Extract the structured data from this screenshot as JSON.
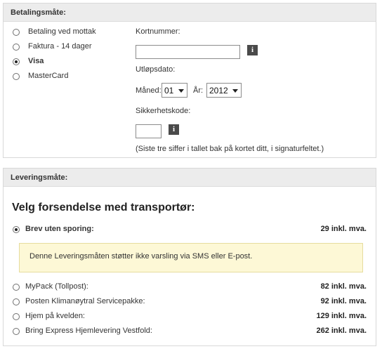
{
  "payment": {
    "header": "Betalingsmåte:",
    "options": [
      {
        "label": "Betaling ved mottak",
        "checked": false
      },
      {
        "label": "Faktura - 14 dager",
        "checked": false
      },
      {
        "label": "Visa",
        "checked": true
      },
      {
        "label": "MasterCard",
        "checked": false
      }
    ],
    "card_number_label": "Kortnummer:",
    "card_number_value": "",
    "expiry_label": "Utløpsdato:",
    "month_label": "Måned:",
    "month_value": "01",
    "year_label": "År:",
    "year_value": "2012",
    "security_code_label": "Sikkerhetskode:",
    "security_code_value": "",
    "security_hint": "(Siste tre siffer i tallet bak på kortet ditt, i signaturfeltet.)",
    "info_glyph": "i"
  },
  "delivery": {
    "header": "Leveringsmåte:",
    "heading": "Velg forsendelse med transportør:",
    "options": [
      {
        "label": "Brev uten sporing:",
        "price": "29 inkl. mva.",
        "checked": true
      },
      {
        "label": "MyPack (Tollpost):",
        "price": "82 inkl. mva.",
        "checked": false
      },
      {
        "label": "Posten Klimanøytral Servicepakke:",
        "price": "92 inkl. mva.",
        "checked": false
      },
      {
        "label": "Hjem på kvelden:",
        "price": "129 inkl. mva.",
        "checked": false
      },
      {
        "label": "Bring Express Hjemlevering Vestfold:",
        "price": "262 inkl. mva.",
        "checked": false
      }
    ],
    "notice": "Denne Leveringsmåten støtter ikke varsling via SMS eller E-post."
  },
  "colors": {
    "header_bg": "#ececec",
    "notice_bg": "#fdf8d6",
    "notice_border": "#e6dc9e",
    "info_button": "#4a4a4a"
  },
  "icons": [
    "radio-icon",
    "info-icon",
    "chevron-down-icon"
  ]
}
